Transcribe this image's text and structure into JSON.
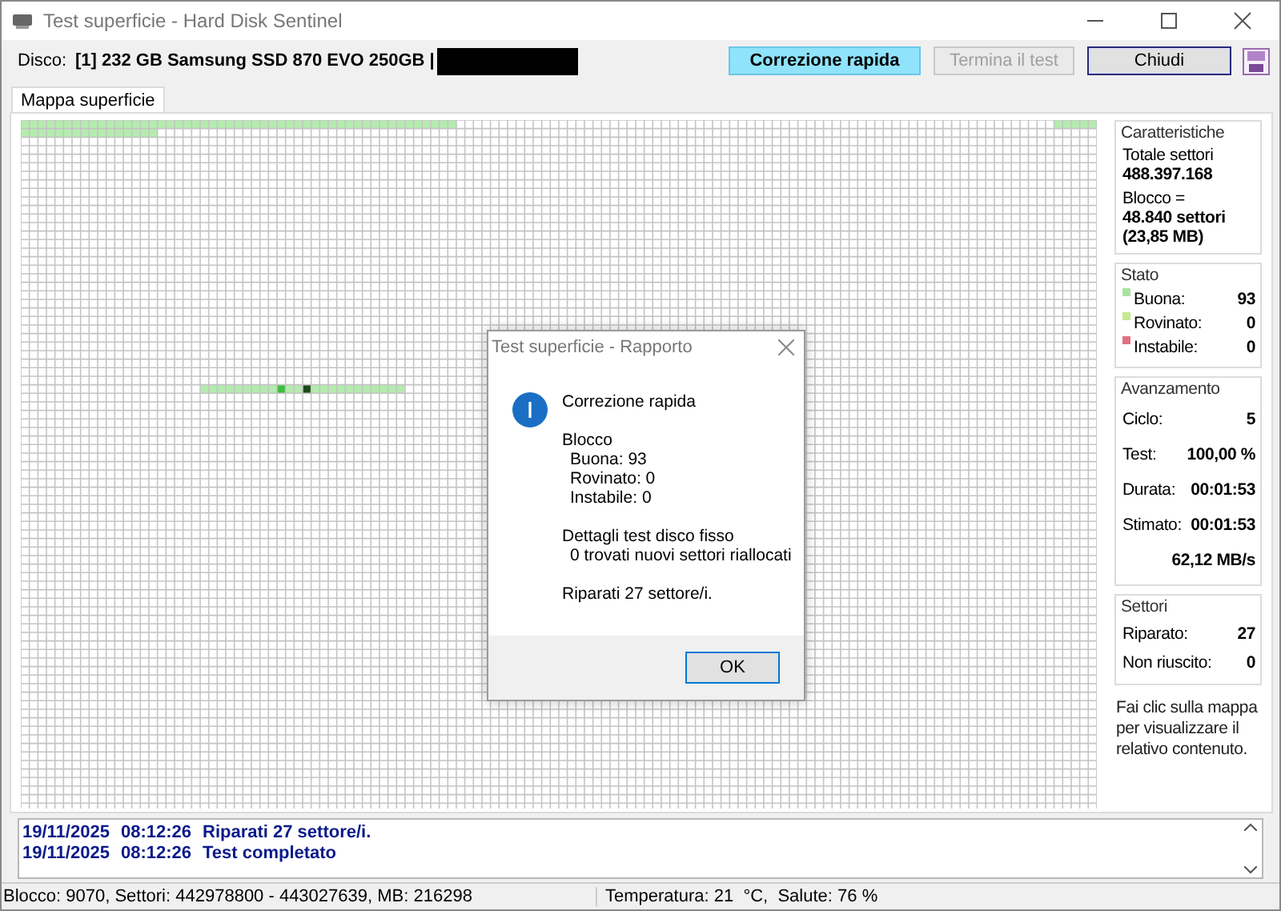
{
  "window": {
    "title": "Test superficie - Hard Disk Sentinel"
  },
  "toolbar": {
    "disk_label": "Disco:",
    "disk_name": "[1] 232 GB  Samsung SSD 870 EVO 250GB |",
    "buttons": [
      {
        "label": "Correzione rapida",
        "kind": "highlighted",
        "disabled": false
      },
      {
        "label": "Termina il test",
        "kind": "normal",
        "disabled": true
      },
      {
        "label": "Chiudi",
        "kind": "default",
        "disabled": false
      }
    ]
  },
  "tabs": [
    {
      "label": "Mappa superficie",
      "selected": true
    }
  ],
  "info": {
    "characteristics": {
      "title": "Caratteristiche",
      "total_label": "Totale settori",
      "total_value": "488.397.168",
      "block_label": "Blocco =",
      "block_sectors": "48.840 settori",
      "block_size": "(23,85 MB)"
    },
    "status": {
      "title": "Stato",
      "items": [
        {
          "label": "Buona:",
          "value": "93",
          "color": "#a8e4a0"
        },
        {
          "label": "Rovinato:",
          "value": "0",
          "color": "#c8e890"
        },
        {
          "label": "Instabile:",
          "value": "0",
          "color": "#e07080"
        }
      ]
    },
    "progress": {
      "title": "Avanzamento",
      "rows": [
        {
          "label": "Ciclo:",
          "value": "5"
        },
        {
          "label": "Test:",
          "value": "100,00 %"
        },
        {
          "label": "Durata:",
          "value": "00:01:53"
        },
        {
          "label": "Stimato:",
          "value": "00:01:53"
        }
      ],
      "speed": "62,12 MB/s"
    },
    "sectors": {
      "title": "Settori",
      "rows": [
        {
          "label": "Riparato:",
          "value": "27"
        },
        {
          "label": "Non riuscito:",
          "value": "0"
        }
      ]
    },
    "hint": "Fai clic sulla mappa per visualizzare il relativo contenuto."
  },
  "log": [
    {
      "date": "19/11/2025",
      "time": "08:12:26",
      "message": "Riparati 27 settore/i."
    },
    {
      "date": "19/11/2025",
      "time": "08:12:26",
      "message": "Test completato"
    }
  ],
  "status_bar": {
    "block_info": "Blocco: 9070, Settori: 442978800 - 443027639, MB: 216298",
    "temperature": "Temperatura: 21  °C,  Salute: 76 %"
  },
  "dialog": {
    "title": "Test superficie - Rapporto",
    "heading": "Correzione rapida",
    "groups": [
      {
        "title": "Blocco",
        "items": [
          "Buona: 93",
          "Rovinato: 0",
          "Instabile: 0"
        ]
      },
      {
        "title": "Dettagli test disco fisso",
        "items": [
          "0 trovati nuovi settori riallocati"
        ]
      },
      {
        "title": "Riparati 27 settore/i."
      }
    ],
    "button": "OK"
  }
}
